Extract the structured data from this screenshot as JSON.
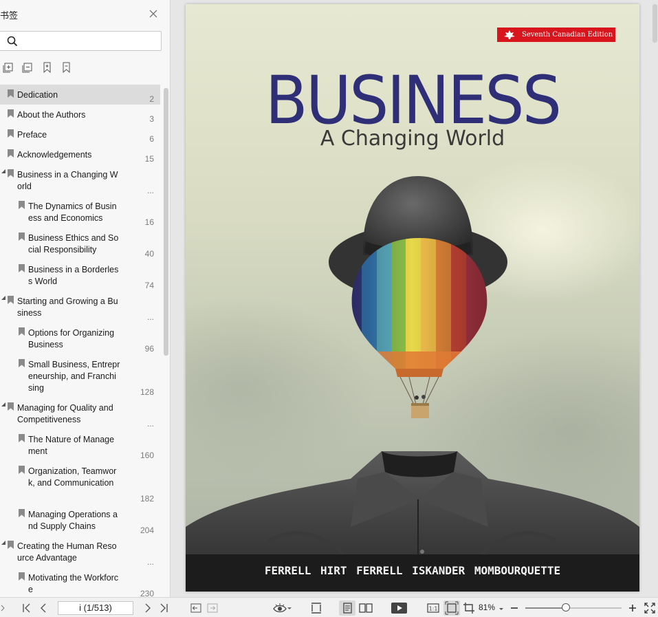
{
  "panel": {
    "title": "书签",
    "search_placeholder": "",
    "bookmarks": [
      {
        "label": "Dedication",
        "page": "2",
        "level": 1,
        "selected": true,
        "expanded": false
      },
      {
        "label": "About the Authors",
        "page": "3",
        "level": 1,
        "expanded": false
      },
      {
        "label": "Preface",
        "page": "6",
        "level": 1,
        "expanded": false
      },
      {
        "label": "Acknowledgements",
        "page": "15",
        "level": 1,
        "expanded": false
      },
      {
        "label": "Business in a Changing World",
        "page": "...",
        "level": 1,
        "expanded": true
      },
      {
        "label": "The Dynamics of Business and Economics",
        "page": "16",
        "level": 2
      },
      {
        "label": "Business Ethics and Social Responsibility",
        "page": "40",
        "level": 2
      },
      {
        "label": "Business in a Borderless World",
        "page": "74",
        "level": 2
      },
      {
        "label": "Starting and Growing a Business",
        "page": "...",
        "level": 1,
        "expanded": true
      },
      {
        "label": "Options for Organizing Business",
        "page": "96",
        "level": 2
      },
      {
        "label": "Small Business, Entrepreneurship, and Franchising",
        "page": "128",
        "level": 2
      },
      {
        "label": "Managing for Quality and Competitiveness",
        "page": "...",
        "level": 1,
        "expanded": true
      },
      {
        "label": "The Nature of Management",
        "page": "160",
        "level": 2
      },
      {
        "label": "Organization, Teamwork, and Communication",
        "page": "182",
        "level": 2
      },
      {
        "label": "Managing Operations and Supply Chains",
        "page": "204",
        "level": 2
      },
      {
        "label": "Creating the Human Resource Advantage",
        "page": "...",
        "level": 1,
        "expanded": true
      },
      {
        "label": "Motivating the Workforce",
        "page": "230",
        "level": 2
      }
    ]
  },
  "cover": {
    "edition": "Seventh Canadian Edition",
    "title": "BUSINESS",
    "subtitle": "A Changing World",
    "authors": "FERRELL  HIRT  FERRELL  ISKANDER  MOMBOURQUETTE"
  },
  "statusbar": {
    "page_indicator": "i (1/513)",
    "zoom": "81%",
    "zoom_fraction": 0.42
  },
  "colors": {
    "title_blue": "#2f2f78",
    "badge_red": "#d8151c",
    "band_dark": "#1c1c1c",
    "selection": "#dcdcdc"
  }
}
